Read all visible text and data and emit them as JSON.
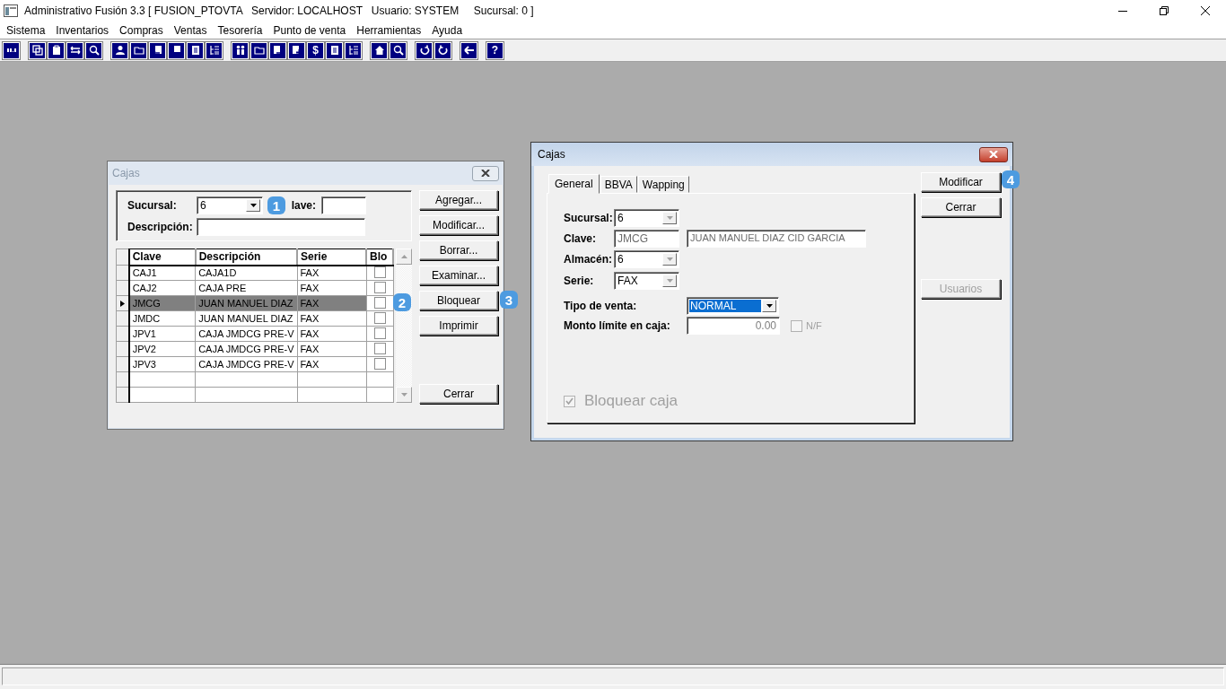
{
  "window": {
    "title": "Administrativo Fusión 3.3 [ FUSION_PTOVTA   Servidor: LOCALHOST   Usuario: SYSTEM     Sucursal: 0 ]"
  },
  "menu": [
    {
      "label": "Sistema"
    },
    {
      "label": "Inventarios"
    },
    {
      "label": "Compras"
    },
    {
      "label": "Ventas"
    },
    {
      "label": "Tesorería"
    },
    {
      "label": "Punto de venta"
    },
    {
      "label": "Herramientas"
    },
    {
      "label": "Ayuda"
    }
  ],
  "toolbar": {
    "currency_glyph": "$",
    "help_glyph": "?"
  },
  "list_dialog": {
    "title": "Cajas",
    "filters": {
      "sucursal": {
        "label": "Sucursal:",
        "value": "6"
      },
      "clave": {
        "label": "lave:"
      },
      "descripcion": {
        "label": "Descripción:"
      }
    },
    "grid": {
      "columns": [
        "Clave",
        "Descripción",
        "Serie",
        "Blo"
      ],
      "rows": [
        {
          "cells": [
            "CAJ1",
            "CAJA1D",
            "FAX"
          ],
          "blocked": false,
          "selected": false
        },
        {
          "cells": [
            "CAJ2",
            "CAJA PRE",
            "FAX"
          ],
          "blocked": false,
          "selected": false
        },
        {
          "cells": [
            "JMCG",
            "JUAN MANUEL DIAZ",
            "FAX"
          ],
          "blocked": false,
          "selected": true
        },
        {
          "cells": [
            "JMDC",
            "JUAN MANUEL DIAZ",
            "FAX"
          ],
          "blocked": false,
          "selected": false
        },
        {
          "cells": [
            "JPV1",
            "CAJA JMDCG PRE-V",
            "FAX"
          ],
          "blocked": false,
          "selected": false
        },
        {
          "cells": [
            "JPV2",
            "CAJA JMDCG PRE-V",
            "FAX"
          ],
          "blocked": false,
          "selected": false
        },
        {
          "cells": [
            "JPV3",
            "CAJA JMDCG PRE-V",
            "FAX"
          ],
          "blocked": false,
          "selected": false
        }
      ]
    },
    "buttons": [
      {
        "label": "Agregar..."
      },
      {
        "label": "Modificar..."
      },
      {
        "label": "Borrar..."
      },
      {
        "label": "Examinar..."
      },
      {
        "label": "Bloquear"
      },
      {
        "label": "Imprimir"
      },
      {
        "label": "Cerrar"
      }
    ]
  },
  "form_dialog": {
    "title": "Cajas",
    "tabs": [
      {
        "label": "General",
        "selected": true
      },
      {
        "label": "BBVA",
        "selected": false
      },
      {
        "label": "Wapping",
        "selected": false
      }
    ],
    "sucursal": {
      "label": "Sucursal:",
      "value": "6"
    },
    "clave": {
      "label": "Clave:",
      "value": "JMCG",
      "description": "JUAN MANUEL DIAZ CID GARCIA"
    },
    "almacen": {
      "label": "Almacén:",
      "value": "6"
    },
    "serie": {
      "label": "Serie:",
      "value": "FAX"
    },
    "tipo_venta": {
      "label": "Tipo de venta:",
      "value": "NORMAL"
    },
    "monto": {
      "label": "Monto límite en caja:",
      "value": "0.00"
    },
    "nf": {
      "label": "N/F",
      "checked": false
    },
    "bloquear": {
      "label": "Bloquear caja",
      "checked": true
    },
    "buttons": [
      {
        "label": "Modificar",
        "disabled": false
      },
      {
        "label": "Cerrar",
        "disabled": false
      },
      {
        "label": "Usuarios",
        "disabled": true
      }
    ]
  },
  "callouts": [
    {
      "label": "1"
    },
    {
      "label": "2"
    },
    {
      "label": "3"
    },
    {
      "label": "4"
    }
  ]
}
